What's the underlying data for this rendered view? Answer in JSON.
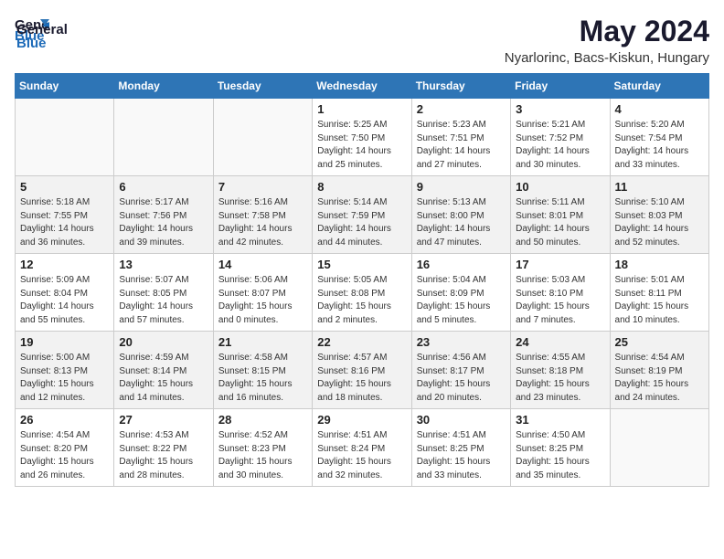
{
  "logo": {
    "general": "General",
    "blue": "Blue"
  },
  "title": "May 2024",
  "subtitle": "Nyarlorinc, Bacs-Kiskun, Hungary",
  "weekdays": [
    "Sunday",
    "Monday",
    "Tuesday",
    "Wednesday",
    "Thursday",
    "Friday",
    "Saturday"
  ],
  "weeks": [
    [
      {
        "day": "",
        "info": ""
      },
      {
        "day": "",
        "info": ""
      },
      {
        "day": "",
        "info": ""
      },
      {
        "day": "1",
        "info": "Sunrise: 5:25 AM\nSunset: 7:50 PM\nDaylight: 14 hours\nand 25 minutes."
      },
      {
        "day": "2",
        "info": "Sunrise: 5:23 AM\nSunset: 7:51 PM\nDaylight: 14 hours\nand 27 minutes."
      },
      {
        "day": "3",
        "info": "Sunrise: 5:21 AM\nSunset: 7:52 PM\nDaylight: 14 hours\nand 30 minutes."
      },
      {
        "day": "4",
        "info": "Sunrise: 5:20 AM\nSunset: 7:54 PM\nDaylight: 14 hours\nand 33 minutes."
      }
    ],
    [
      {
        "day": "5",
        "info": "Sunrise: 5:18 AM\nSunset: 7:55 PM\nDaylight: 14 hours\nand 36 minutes."
      },
      {
        "day": "6",
        "info": "Sunrise: 5:17 AM\nSunset: 7:56 PM\nDaylight: 14 hours\nand 39 minutes."
      },
      {
        "day": "7",
        "info": "Sunrise: 5:16 AM\nSunset: 7:58 PM\nDaylight: 14 hours\nand 42 minutes."
      },
      {
        "day": "8",
        "info": "Sunrise: 5:14 AM\nSunset: 7:59 PM\nDaylight: 14 hours\nand 44 minutes."
      },
      {
        "day": "9",
        "info": "Sunrise: 5:13 AM\nSunset: 8:00 PM\nDaylight: 14 hours\nand 47 minutes."
      },
      {
        "day": "10",
        "info": "Sunrise: 5:11 AM\nSunset: 8:01 PM\nDaylight: 14 hours\nand 50 minutes."
      },
      {
        "day": "11",
        "info": "Sunrise: 5:10 AM\nSunset: 8:03 PM\nDaylight: 14 hours\nand 52 minutes."
      }
    ],
    [
      {
        "day": "12",
        "info": "Sunrise: 5:09 AM\nSunset: 8:04 PM\nDaylight: 14 hours\nand 55 minutes."
      },
      {
        "day": "13",
        "info": "Sunrise: 5:07 AM\nSunset: 8:05 PM\nDaylight: 14 hours\nand 57 minutes."
      },
      {
        "day": "14",
        "info": "Sunrise: 5:06 AM\nSunset: 8:07 PM\nDaylight: 15 hours\nand 0 minutes."
      },
      {
        "day": "15",
        "info": "Sunrise: 5:05 AM\nSunset: 8:08 PM\nDaylight: 15 hours\nand 2 minutes."
      },
      {
        "day": "16",
        "info": "Sunrise: 5:04 AM\nSunset: 8:09 PM\nDaylight: 15 hours\nand 5 minutes."
      },
      {
        "day": "17",
        "info": "Sunrise: 5:03 AM\nSunset: 8:10 PM\nDaylight: 15 hours\nand 7 minutes."
      },
      {
        "day": "18",
        "info": "Sunrise: 5:01 AM\nSunset: 8:11 PM\nDaylight: 15 hours\nand 10 minutes."
      }
    ],
    [
      {
        "day": "19",
        "info": "Sunrise: 5:00 AM\nSunset: 8:13 PM\nDaylight: 15 hours\nand 12 minutes."
      },
      {
        "day": "20",
        "info": "Sunrise: 4:59 AM\nSunset: 8:14 PM\nDaylight: 15 hours\nand 14 minutes."
      },
      {
        "day": "21",
        "info": "Sunrise: 4:58 AM\nSunset: 8:15 PM\nDaylight: 15 hours\nand 16 minutes."
      },
      {
        "day": "22",
        "info": "Sunrise: 4:57 AM\nSunset: 8:16 PM\nDaylight: 15 hours\nand 18 minutes."
      },
      {
        "day": "23",
        "info": "Sunrise: 4:56 AM\nSunset: 8:17 PM\nDaylight: 15 hours\nand 20 minutes."
      },
      {
        "day": "24",
        "info": "Sunrise: 4:55 AM\nSunset: 8:18 PM\nDaylight: 15 hours\nand 23 minutes."
      },
      {
        "day": "25",
        "info": "Sunrise: 4:54 AM\nSunset: 8:19 PM\nDaylight: 15 hours\nand 24 minutes."
      }
    ],
    [
      {
        "day": "26",
        "info": "Sunrise: 4:54 AM\nSunset: 8:20 PM\nDaylight: 15 hours\nand 26 minutes."
      },
      {
        "day": "27",
        "info": "Sunrise: 4:53 AM\nSunset: 8:22 PM\nDaylight: 15 hours\nand 28 minutes."
      },
      {
        "day": "28",
        "info": "Sunrise: 4:52 AM\nSunset: 8:23 PM\nDaylight: 15 hours\nand 30 minutes."
      },
      {
        "day": "29",
        "info": "Sunrise: 4:51 AM\nSunset: 8:24 PM\nDaylight: 15 hours\nand 32 minutes."
      },
      {
        "day": "30",
        "info": "Sunrise: 4:51 AM\nSunset: 8:25 PM\nDaylight: 15 hours\nand 33 minutes."
      },
      {
        "day": "31",
        "info": "Sunrise: 4:50 AM\nSunset: 8:25 PM\nDaylight: 15 hours\nand 35 minutes."
      },
      {
        "day": "",
        "info": ""
      }
    ]
  ]
}
